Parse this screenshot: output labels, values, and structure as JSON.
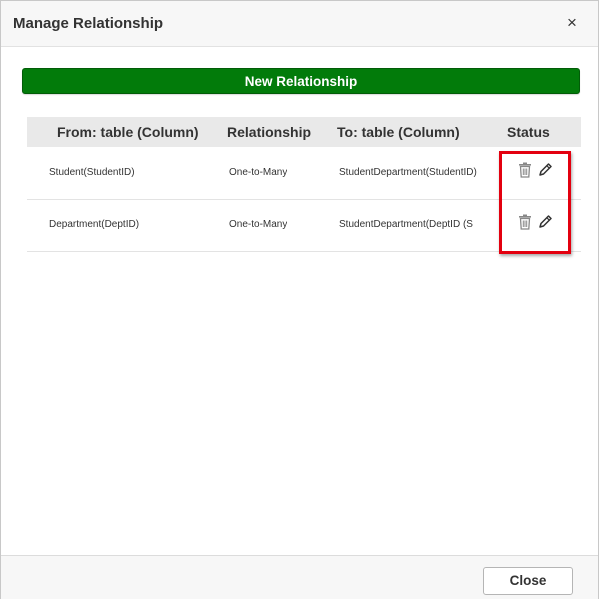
{
  "dialog": {
    "title": "Manage Relationship",
    "close_icon_glyph": "×"
  },
  "toolbar": {
    "new_relationship_label": "New Relationship",
    "accent_color": "#027b0a"
  },
  "grid": {
    "columns": [
      "From: table (Column)",
      "Relationship",
      "To: table (Column)",
      "Status"
    ],
    "rows": [
      {
        "from": "Student(StudentID)",
        "relationship": "One-to-Many",
        "to": "StudentDepartment(StudentID)",
        "status_icons": [
          "trash-icon",
          "pencil-icon"
        ]
      },
      {
        "from": "Department(DeptID)",
        "relationship": "One-to-Many",
        "to": "StudentDepartment(DeptID (S",
        "status_icons": [
          "trash-icon",
          "pencil-icon"
        ]
      }
    ]
  },
  "annotation": {
    "highlight_color": "#e3000f"
  },
  "footer": {
    "close_label": "Close"
  }
}
